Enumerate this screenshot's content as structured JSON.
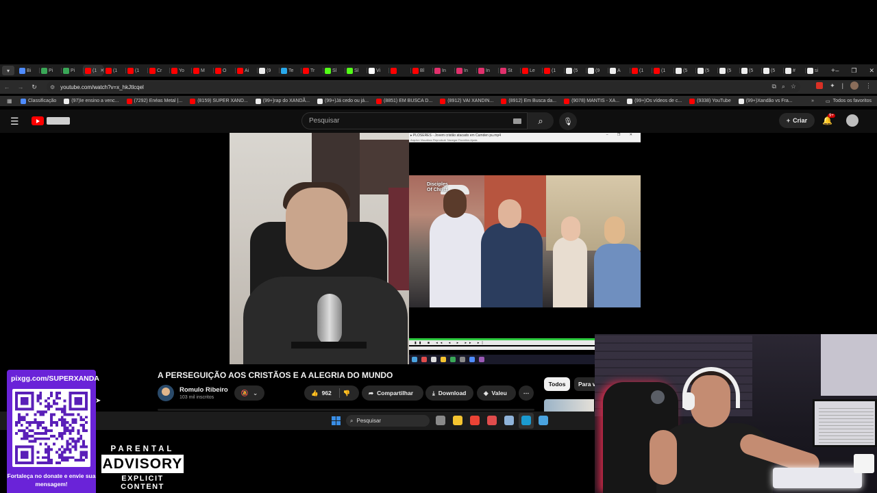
{
  "browser": {
    "tab_menu_icon": "chevron-down-icon",
    "tabs": [
      {
        "label": "Bi",
        "color": "#4f8cff"
      },
      {
        "label": "Pi",
        "color": "#3aa757"
      },
      {
        "label": "Pi",
        "color": "#3aa757"
      },
      {
        "label": "(1",
        "color": "#ff0000",
        "active": true
      },
      {
        "label": "(1",
        "color": "#ff0000"
      },
      {
        "label": "(1",
        "color": "#ff0000"
      },
      {
        "label": "Cr",
        "color": "#ff0000"
      },
      {
        "label": "Yo",
        "color": "#ff0000"
      },
      {
        "label": "M",
        "color": "#ff0000"
      },
      {
        "label": "O",
        "color": "#ff0000"
      },
      {
        "label": "Ai",
        "color": "#ff0000"
      },
      {
        "label": "(9",
        "color": "#eeeeee"
      },
      {
        "label": "Te",
        "color": "#29a9eb"
      },
      {
        "label": "Tr",
        "color": "#ff0000"
      },
      {
        "label": "Sl",
        "color": "#53fc18"
      },
      {
        "label": "Sl",
        "color": "#53fc18"
      },
      {
        "label": "Vi",
        "color": "#ffffff"
      },
      {
        "label": "",
        "color": "#ff0000"
      },
      {
        "label": "Bl",
        "color": "#ff0000"
      },
      {
        "label": "In",
        "color": "#e1306c"
      },
      {
        "label": "In",
        "color": "#e1306c"
      },
      {
        "label": "In",
        "color": "#e1306c"
      },
      {
        "label": "St",
        "color": "#e1306c"
      },
      {
        "label": "Le",
        "color": "#ff0000"
      },
      {
        "label": "(1",
        "color": "#ff0000"
      },
      {
        "label": "(5",
        "color": "#eeeeee"
      },
      {
        "label": "(9",
        "color": "#eeeeee"
      },
      {
        "label": "A",
        "color": "#eeeeee"
      },
      {
        "label": "(1",
        "color": "#ff0000"
      },
      {
        "label": "(1",
        "color": "#ff0000"
      },
      {
        "label": "(5",
        "color": "#eeeeee"
      },
      {
        "label": "(5",
        "color": "#eeeeee"
      },
      {
        "label": "(5",
        "color": "#eeeeee"
      },
      {
        "label": "(5",
        "color": "#eeeeee"
      },
      {
        "label": "(5",
        "color": "#eeeeee"
      },
      {
        "label": "#",
        "color": "#eeeeee"
      },
      {
        "label": "si",
        "color": "#eeeeee"
      }
    ],
    "new_tab": "+",
    "window_controls": [
      "–",
      "❐",
      "✕"
    ],
    "url": "youtube.com/watch?v=x_hkJtlcqel",
    "bookmarks": [
      {
        "label": "Classificação",
        "color": "#4f8cff"
      },
      {
        "label": "(97)Ie ensino a venc...",
        "color": "#eeeeee"
      },
      {
        "label": "(7292) Enéas Metal |...",
        "color": "#ff0000"
      },
      {
        "label": "(8159) SUPER XAND...",
        "color": "#ff0000"
      },
      {
        "label": "(99+)rap do XANDÃ...",
        "color": "#eeeeee"
      },
      {
        "label": "(99+)Já cedo ou já...",
        "color": "#eeeeee"
      },
      {
        "label": "(8851) EM BUSCA D...",
        "color": "#ff0000"
      },
      {
        "label": "(8912) VAI XANDIN...",
        "color": "#ff0000"
      },
      {
        "label": "(8912) Em Busca da...",
        "color": "#ff0000"
      },
      {
        "label": "(9078) MANTIS - XA...",
        "color": "#ff0000"
      },
      {
        "label": "(99+)Os vídeos de c...",
        "color": "#eeeeee"
      },
      {
        "label": "(9338) YouTube",
        "color": "#ff0000"
      },
      {
        "label": "(99+)Xandão vs Fra...",
        "color": "#eeeeee"
      }
    ],
    "all_bookmarks": "Todos os favoritos"
  },
  "youtube": {
    "search_placeholder": "Pesquisar",
    "create_label": "Criar",
    "notif_count": "9+",
    "video_title": "A PERSEGUIÇÃO AOS CRISTÃOS E A ALEGRIA DO MUNDO",
    "channel_name": "Romulo Ribeiro",
    "subscribers": "103 mil inscritos",
    "likes": "962",
    "share_label": "Compartilhar",
    "download_label": "Download",
    "thanks_label": "Valeu",
    "chips": [
      "Todos",
      "Para v"
    ]
  },
  "embedded_player": {
    "title": "▸ PLOSERES - Jovem cristão atacado em Camden pu.mp4",
    "menu": "Arquivo  Visualizar  Reproduzir  Navegar  Favoritos  Ajuda",
    "watermark": "Disciples\nOf Christ"
  },
  "taskbar": {
    "search_label": "Pesquisar",
    "apps": [
      "#8a8a8a",
      "#f4c430",
      "#ea4335",
      "#e04c4c",
      "#8fb3d9",
      "#1b9bd1",
      "#4aa3df"
    ]
  },
  "overlay": {
    "donate_url": "pixgg.com/SUPERXANDA",
    "donate_message": "Fortaleça no donate e envie sua mensagem!",
    "advisory_top": "PARENTAL",
    "advisory_mid": "ADVISORY",
    "advisory_bot": "EXPLICIT CONTENT"
  },
  "colors": {
    "accent": "#ff0000",
    "donate_bg": "#6a23d8"
  }
}
